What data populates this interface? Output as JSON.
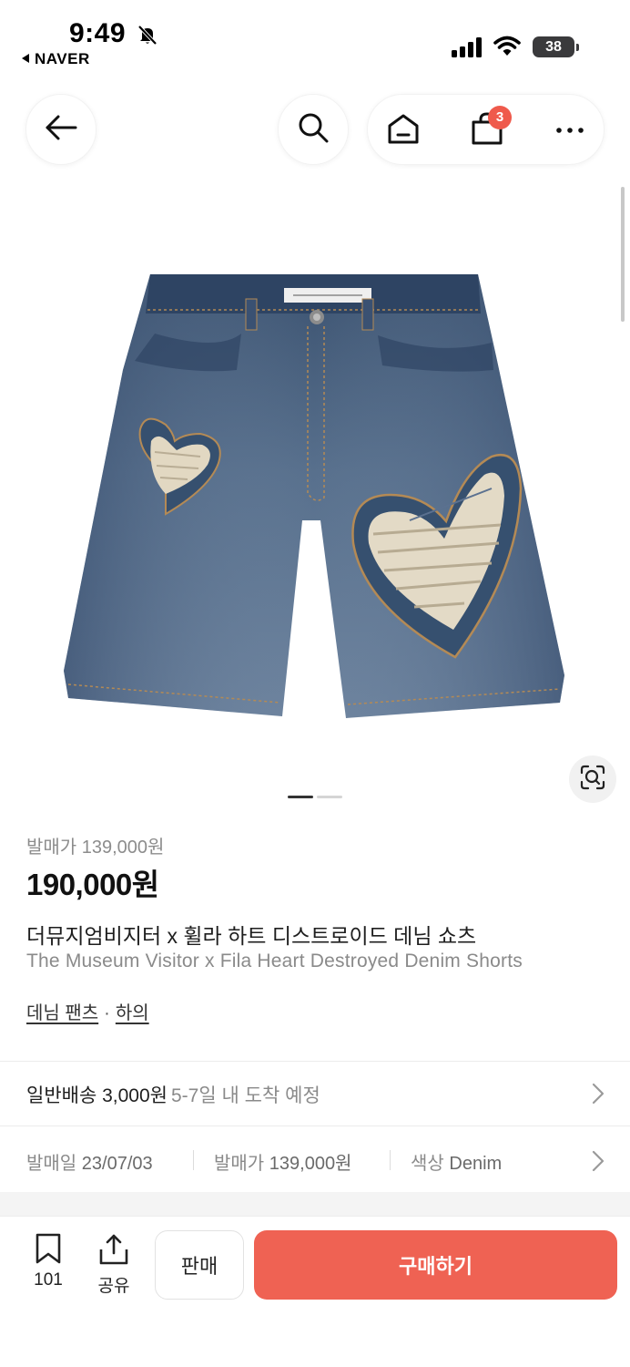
{
  "status_bar": {
    "time": "9:49",
    "back_app": "NAVER",
    "battery": "38"
  },
  "nav": {
    "cart_count": "3"
  },
  "product": {
    "release_price": "발매가 139,000원",
    "price": "190,000원",
    "name_ko": "더뮤지엄비지터 x 휠라 하트 디스트로이드 데님 쇼츠",
    "name_en": "The Museum Visitor x Fila Heart Destroyed Denim Shorts",
    "category_1": "데님 팬츠",
    "category_sep": "·",
    "category_2": "하의",
    "image_pager": {
      "total": 2,
      "current": 1
    }
  },
  "shipping": {
    "label": "일반배송 3,000원",
    "eta": "5-7일 내 도착 예정"
  },
  "meta": {
    "release_date_label": "발매일",
    "release_date": "23/07/03",
    "release_price_label": "발매가",
    "release_price": "139,000원",
    "color_label": "색상",
    "color": "Denim"
  },
  "bottom": {
    "bookmark_count": "101",
    "share_label": "공유",
    "sell_label": "판매",
    "buy_label": "구매하기"
  },
  "colors": {
    "accent": "#ef6253",
    "badge": "#ef5a4c"
  }
}
